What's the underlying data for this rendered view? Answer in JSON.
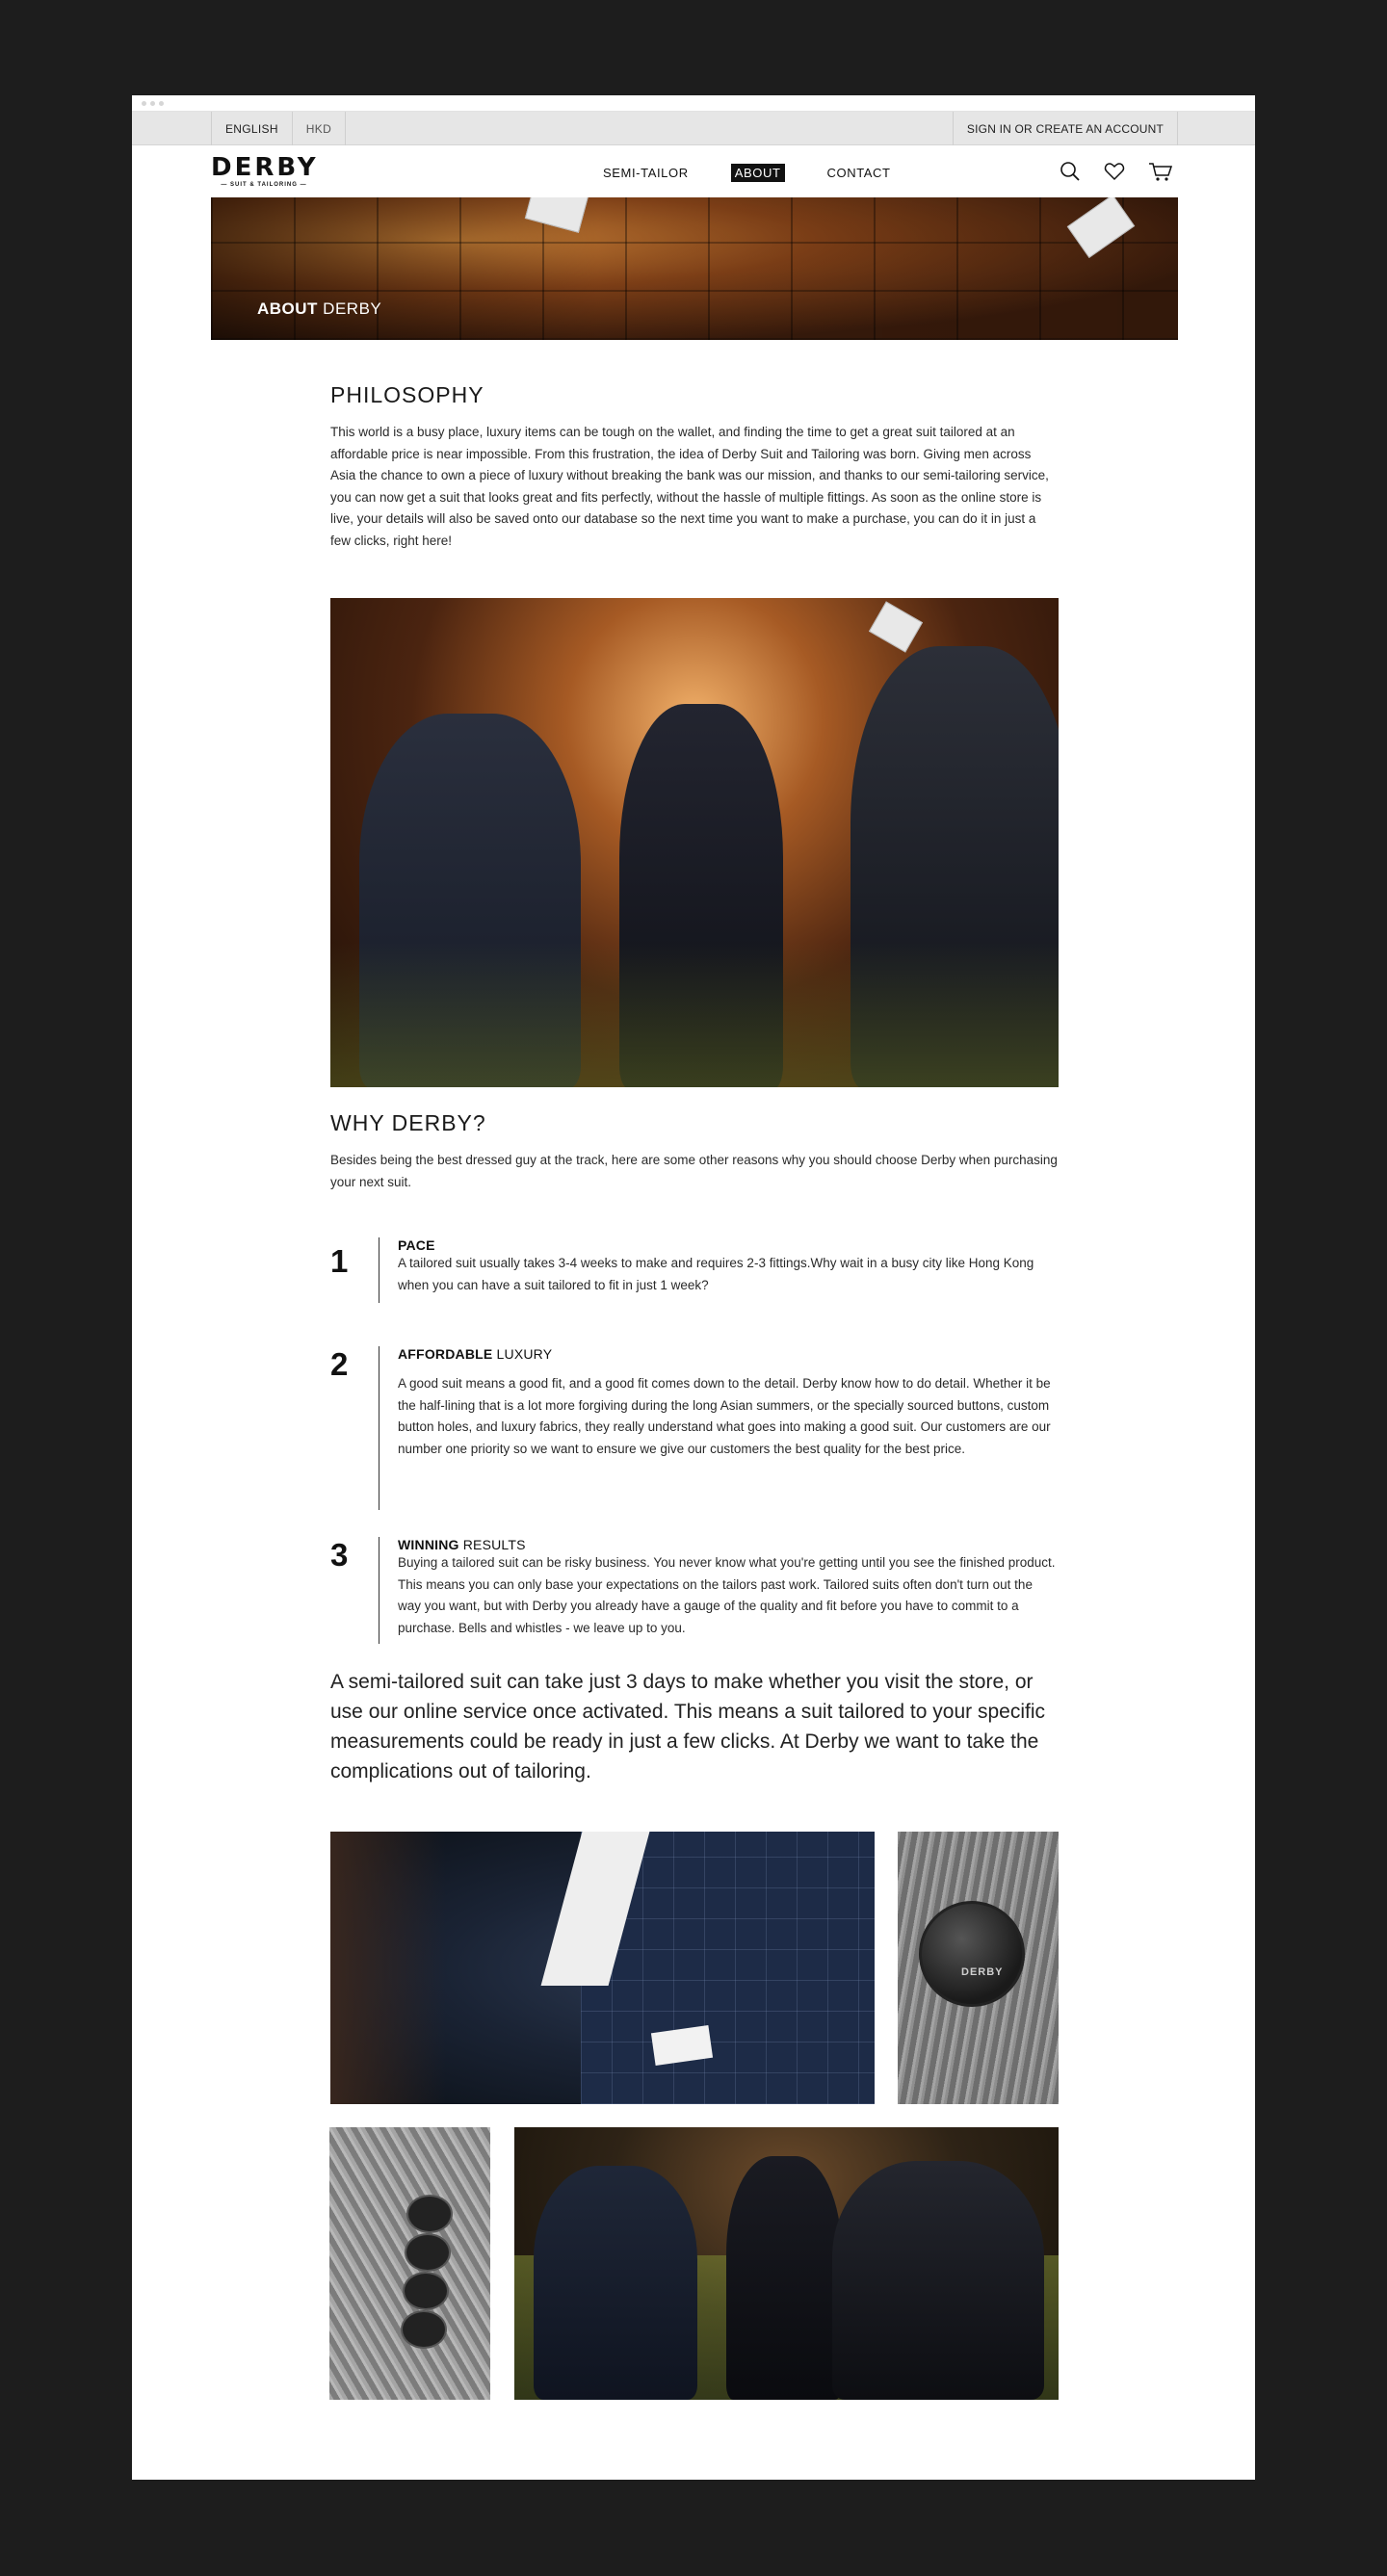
{
  "utility_bar": {
    "language": "ENGLISH",
    "currency": "HKD",
    "sign_in": "SIGN IN OR CREATE AN ACCOUNT"
  },
  "nav": {
    "logo": "DERBY",
    "logo_sub": "— SUIT & TAILORING —",
    "links": [
      "SEMI-TAILOR",
      "ABOUT",
      "CONTACT"
    ],
    "active": "ABOUT",
    "icons": [
      "search-icon",
      "heart-icon",
      "cart-icon"
    ]
  },
  "hero": {
    "title_bold": "ABOUT",
    "title_rest": " DERBY"
  },
  "philosophy": {
    "heading": "PHILOSOPHY",
    "text": "This world is a busy place, luxury items can be tough on the wallet, and finding the time to get a great suit tailored at an affordable price is near impossible. From this frustration, the idea of Derby Suit and Tailoring was born. Giving men across Asia the chance to own a piece of luxury without breaking the bank was our mission, and thanks to our semi-tailoring service, you can now get a suit that looks great and fits perfectly, without the hassle of multiple fittings. As soon as the online store is live, your details will also be saved onto our database so the next time you want to make a purchase, you can do it in just a few clicks, right here!"
  },
  "why": {
    "heading": "WHY DERBY?",
    "intro": "Besides being the best dressed guy at the track, here are some other reasons why you should choose Derby when purchasing your next suit.",
    "reasons": [
      {
        "number": "1",
        "title_bold": "PACE",
        "title_rest": "",
        "text": "A tailored suit usually takes 3-4 weeks to make and requires 2-3 fittings.Why wait in a busy city like Hong Kong when you can have a suit tailored to fit in just 1 week?"
      },
      {
        "number": "2",
        "title_bold": "AFFORDABLE",
        "title_rest": " LUXURY",
        "text": "A good suit means a good fit, and a good fit comes down to the detail. Derby know how to do detail. Whether it be the half-lining that is a lot more forgiving during the long Asian summers, or the specially sourced buttons, custom button holes, and luxury fabrics, they really understand what goes into making a good suit. Our customers are our number one priority so we want to ensure we give our customers the best quality for the best price."
      },
      {
        "number": "3",
        "title_bold": "WINNING",
        "title_rest": " RESULTS",
        "text": "Buying a tailored suit can be risky business. You never know what you're getting until you see the finished product. This means you can only base your expectations on the tailors past work. Tailored suits often don't turn out the way you want, but with Derby you already have a gauge of the quality and fit before you have to commit to a purchase. Bells and whistles - we leave up to you."
      }
    ]
  },
  "lead": "A semi-tailored suit can take just 3 days to make whether you visit the store, or use our online service once activated. This means a suit tailored to your specific measurements could be ready in just a few clicks. At Derby we want to take the complications out of tailoring.",
  "gallery": {
    "button_text": "DERBY"
  }
}
